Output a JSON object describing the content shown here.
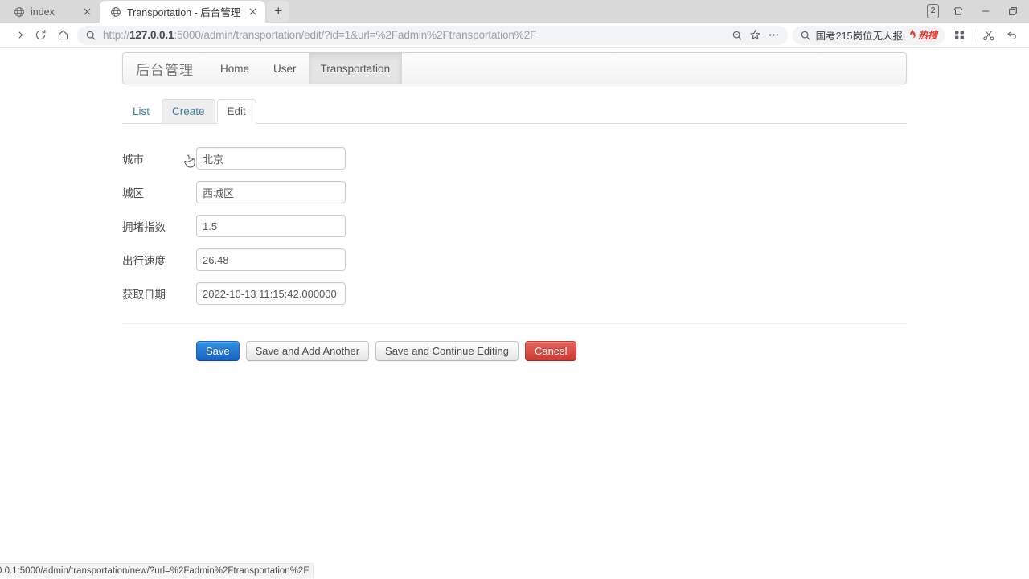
{
  "browser": {
    "tabs": [
      {
        "title": "index",
        "favicon": "globe-icon",
        "active": false
      },
      {
        "title": "Transportation - 后台管理",
        "favicon": "globe-icon",
        "active": true
      }
    ],
    "new_tab_label": "+",
    "tab_count_badge": "2",
    "window_controls": {
      "collections": "collections-icon",
      "minimize": "−",
      "restore": "restore-icon"
    },
    "toolbar": {
      "forward": "forward-arrow-icon",
      "reload": "reload-icon",
      "home": "home-icon",
      "address_search_icon": "search-icon",
      "url_prefix": "http://",
      "url_host": "127.0.0.1",
      "url_rest": ":5000/admin/transportation/edit/?id=1&url=%2Fadmin%2Ftransportation%2F",
      "zoom_out": "zoom-out-icon",
      "favorite": "star-icon",
      "more": "ellipsis-icon",
      "search_icon": "search-icon",
      "search_text": "国考215岗位无人报",
      "hot_badge": "热搜",
      "hot_badge_color": "#e5332a",
      "apps": "apps-grid-icon",
      "capture": "scissors-icon",
      "undo": "undo-arrow-icon"
    },
    "status_bar_url": "0.0.1:5000/admin/transportation/new/?url=%2Fadmin%2Ftransportation%2F"
  },
  "navbar": {
    "brand": "后台管理",
    "items": [
      {
        "label": "Home",
        "active": false
      },
      {
        "label": "User",
        "active": false
      },
      {
        "label": "Transportation",
        "active": true
      }
    ]
  },
  "tabs": [
    {
      "label": "List",
      "state": "normal"
    },
    {
      "label": "Create",
      "state": "hover"
    },
    {
      "label": "Edit",
      "state": "active"
    }
  ],
  "form": {
    "fields": [
      {
        "label": "城市",
        "value": "北京"
      },
      {
        "label": "城区",
        "value": "西城区"
      },
      {
        "label": "拥堵指数",
        "value": "1.5"
      },
      {
        "label": "出行速度",
        "value": "26.48"
      },
      {
        "label": "获取日期",
        "value": "2022-10-13 11:15:42.000000"
      }
    ]
  },
  "actions": [
    {
      "label": "Save",
      "style": "primary"
    },
    {
      "label": "Save and Add Another",
      "style": "default"
    },
    {
      "label": "Save and Continue Editing",
      "style": "default"
    },
    {
      "label": "Cancel",
      "style": "danger"
    }
  ],
  "colors": {
    "primary": "#1a62c4",
    "danger": "#cd3a32",
    "link": "#3f7f9b",
    "active_nav_bg": "#e5e5e5"
  }
}
